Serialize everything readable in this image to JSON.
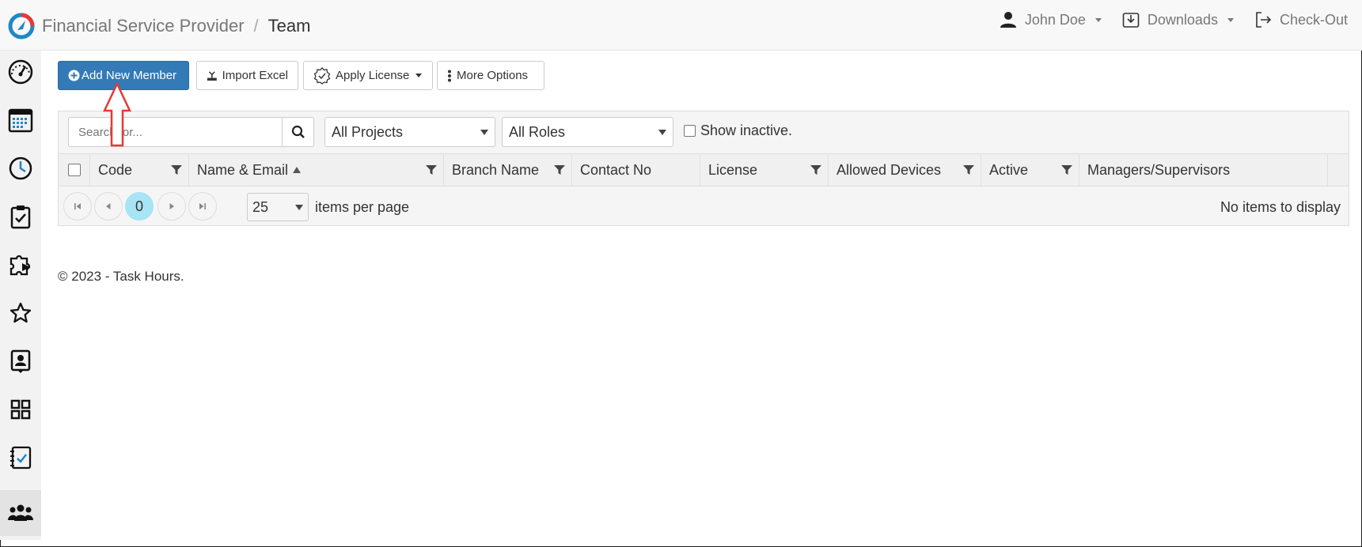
{
  "header": {
    "brand": "Financial Service Provider",
    "separator": "/",
    "current_page": "Team",
    "user_name": "John Doe",
    "downloads_label": "Downloads",
    "checkout_label": "Check-Out"
  },
  "sidebar": {
    "items": [
      {
        "icon": "dashboard-icon"
      },
      {
        "icon": "calendar-icon"
      },
      {
        "icon": "clock-icon"
      },
      {
        "icon": "clipboard-check-icon"
      },
      {
        "icon": "puzzle-icon"
      },
      {
        "icon": "star-icon"
      },
      {
        "icon": "contact-icon"
      },
      {
        "icon": "grid-icon"
      },
      {
        "icon": "checklist-icon"
      },
      {
        "icon": "team-icon",
        "active": true
      }
    ]
  },
  "toolbar": {
    "add_member_label": "Add New Member",
    "import_excel_label": "Import Excel",
    "apply_license_label": "Apply License",
    "more_options_label": "More Options"
  },
  "filters": {
    "search_placeholder": "Search for...",
    "projects_value": "All Projects",
    "roles_value": "All Roles",
    "show_inactive_label": "Show inactive."
  },
  "table": {
    "columns": [
      "Code",
      "Name & Email",
      "Branch Name",
      "Contact No",
      "License",
      "Allowed Devices",
      "Active",
      "Managers/Supervisors"
    ]
  },
  "pager": {
    "current_page": "0",
    "per_page": "25",
    "per_page_label": "items per page",
    "status": "No items to display"
  },
  "footer": {
    "text": "© 2023 - Task Hours."
  },
  "colors": {
    "primary": "#337ab7",
    "current_page_bg": "#a7e4f5",
    "annotation_arrow": "#e53935"
  }
}
